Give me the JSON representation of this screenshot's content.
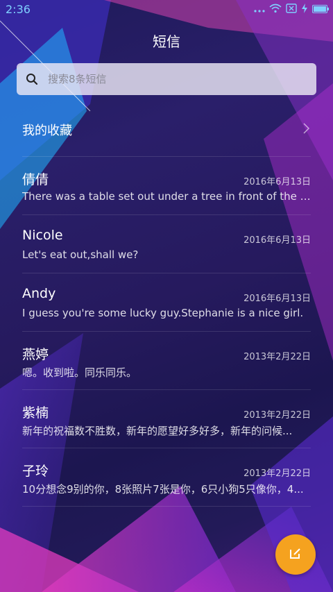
{
  "status_bar": {
    "time": "2:36",
    "icons": [
      "dots-icon",
      "wifi-icon",
      "sim-off-icon",
      "charging-icon",
      "battery-icon"
    ]
  },
  "header": {
    "title": "短信"
  },
  "search": {
    "placeholder": "搜索8条短信"
  },
  "favorites": {
    "label": "我的收藏"
  },
  "conversations": [
    {
      "name": "倩倩",
      "date": "2016年6月13日",
      "preview": "There was a table set out under a tree in front of the ho..."
    },
    {
      "name": "Nicole",
      "date": "2016年6月13日",
      "preview": "Let's eat out,shall we?"
    },
    {
      "name": "Andy",
      "date": "2016年6月13日",
      "preview": "I guess you're some lucky guy.Stephanie is a nice girl."
    },
    {
      "name": "燕婷",
      "date": "2013年2月22日",
      "preview": "嗯。收到啦。同乐同乐。"
    },
    {
      "name": "紫楠",
      "date": "2013年2月22日",
      "preview": "新年的祝福数不胜数，新年的愿望好多好多，新年的问候..."
    },
    {
      "name": "子玲",
      "date": "2013年2月22日",
      "preview": "10分想念9别的你，8张照片7张是你，6只小狗5只像你，4..."
    }
  ],
  "fab": {
    "icon": "compose-icon",
    "color": "#f5a21f"
  }
}
